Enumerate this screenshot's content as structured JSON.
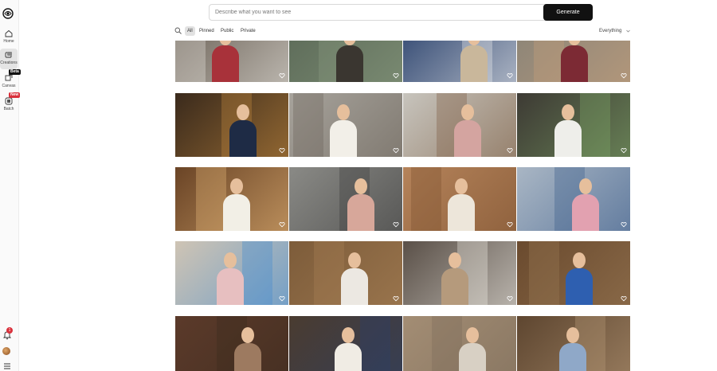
{
  "sidebar": {
    "items": [
      {
        "label": "Home",
        "icon": "home-icon"
      },
      {
        "label": "Creations",
        "icon": "creations-icon",
        "active": true
      },
      {
        "label": "Canvas",
        "icon": "canvas-icon",
        "badge": "Beta"
      },
      {
        "label": "Batch",
        "icon": "batch-icon",
        "badge": "New"
      }
    ],
    "notification_count": "1"
  },
  "prompt": {
    "placeholder": "Describe what you want to see",
    "value": "",
    "generate_label": "Generate"
  },
  "filters": {
    "tabs": [
      "All",
      "Pinned",
      "Public",
      "Private"
    ],
    "active": "All",
    "scope": "Everything"
  },
  "gallery": {
    "tiles": [
      {
        "bg": "#6b6156",
        "fig": "#a8323a",
        "accent": "#e8e6e0",
        "desc": "woman red coat window"
      },
      {
        "bg": "#5c6a58",
        "fig": "#3a3630",
        "accent": "#8a9c80",
        "desc": "woman binoculars"
      },
      {
        "bg": "#2f4670",
        "fig": "#c9b79b",
        "accent": "#f2f2f2",
        "desc": "woman porch blue house"
      },
      {
        "bg": "#8a8478",
        "fig": "#7c2a34",
        "accent": "#c8a17c",
        "desc": "woman camel coat"
      },
      {
        "bg": "#3a2a1c",
        "fig": "#1e2b45",
        "accent": "#c48a3e",
        "desc": "woman at door lamp"
      },
      {
        "bg": "#a7a39c",
        "fig": "#f2efe8",
        "accent": "#6a6258",
        "desc": "woman white shirt surprised"
      },
      {
        "bg": "#c7c4bd",
        "fig": "#d4a4a0",
        "accent": "#7a5a3e",
        "desc": "woman pink dress door"
      },
      {
        "bg": "#3d3a34",
        "fig": "#eeeeea",
        "accent": "#7fa868",
        "desc": "woman shopping bags"
      },
      {
        "bg": "#6a4426",
        "fig": "#f2efe6",
        "accent": "#e9b97a",
        "desc": "woman headscarf lamp"
      },
      {
        "bg": "#8a8a86",
        "fig": "#d7a79a",
        "accent": "#3a3a3a",
        "desc": "woman shadow man hat"
      },
      {
        "bg": "#b5835a",
        "fig": "#ede6da",
        "accent": "#7a4f2e",
        "desc": "woman glasses brick"
      },
      {
        "bg": "#a9b6c4",
        "fig": "#e2a1b0",
        "accent": "#3a5b8a",
        "desc": "woman pink dress tiles"
      },
      {
        "bg": "#cfc4b4",
        "fig": "#e7bfc0",
        "accent": "#3f8ad1",
        "desc": "woman doors teal skirt"
      },
      {
        "bg": "#7d5c3a",
        "fig": "#ece8e2",
        "accent": "#a98257",
        "desc": "woman folder door"
      },
      {
        "bg": "#5a5048",
        "fig": "#b59a7c",
        "accent": "#f0ede6",
        "desc": "woman hat vest doors"
      },
      {
        "bg": "#6a4a2e",
        "fig": "#2e5fb0",
        "accent": "#9a7a56",
        "desc": "woman blue dress door"
      },
      {
        "bg": "#5b3a2a",
        "fig": "#9d7a60",
        "accent": "#3a2a1e",
        "desc": "woman coat brick door"
      },
      {
        "bg": "#4a3c30",
        "fig": "#f0ece4",
        "accent": "#2a3f6a",
        "desc": "woman apron door"
      },
      {
        "bg": "#a38d74",
        "fig": "#d8d0c4",
        "accent": "#7a6a58",
        "desc": "woman large doors"
      },
      {
        "bg": "#5e4630",
        "fig": "#8fa8c8",
        "accent": "#b89a78",
        "desc": "woman blue dress entry"
      }
    ]
  }
}
